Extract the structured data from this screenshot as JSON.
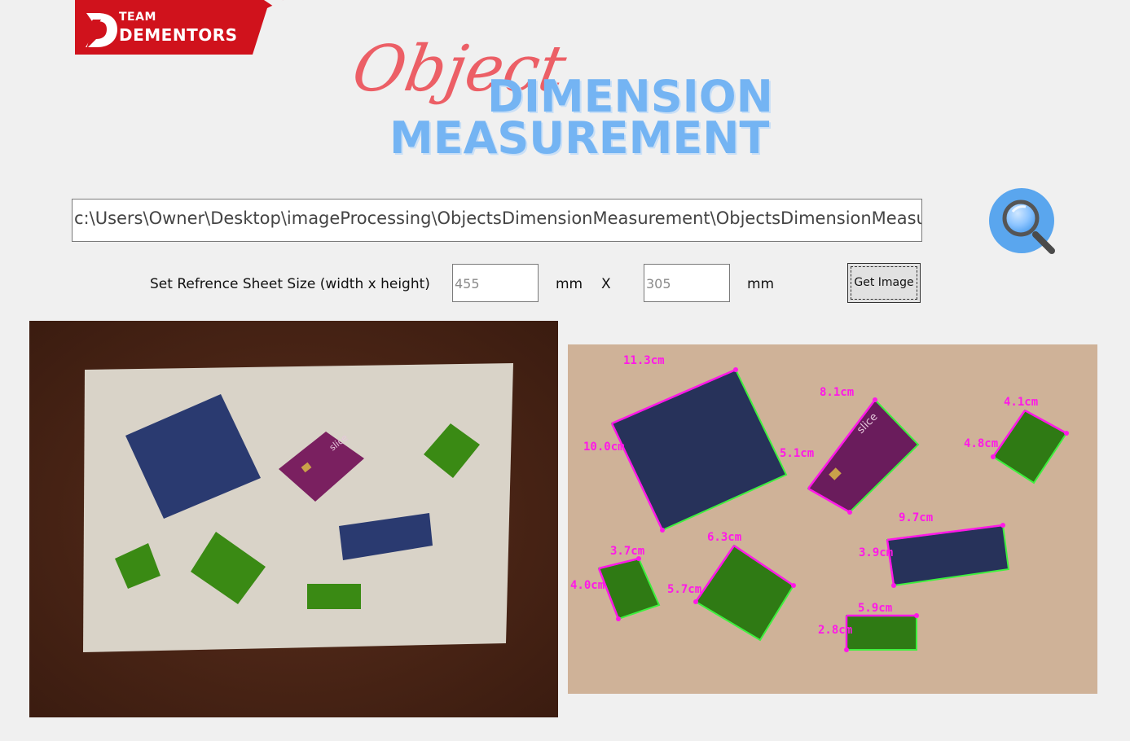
{
  "logo": {
    "team": "TEAM",
    "brand": "DEMENTORS",
    "mark": "D",
    "color": "#d0121c"
  },
  "title": {
    "script": "Object",
    "line1": "DIMENSION",
    "line2": "MEASUREMENT"
  },
  "path_field": {
    "value": "c:\\Users\\Owner\\Desktop\\imageProcessing\\ObjectsDimensionMeasurement\\ObjectsDimensionMeasur"
  },
  "search": {
    "icon": "search-icon"
  },
  "reference": {
    "label": "Set Refrence Sheet Size (width x height)",
    "width": "455",
    "height": "305",
    "unit_width": "mm",
    "separator": "X",
    "unit_height": "mm",
    "button": "Get Image"
  },
  "measurements": {
    "blue_square_width": "11.3cm",
    "blue_square_height": "10.0cm",
    "card_width": "8.1cm",
    "card_height": "5.1cm",
    "green_top_right_width": "4.1cm",
    "green_top_right_height": "4.8cm",
    "blue_rect_width": "9.7cm",
    "blue_rect_height": "3.9cm",
    "green_small_width": "3.7cm",
    "green_small_height": "4.0cm",
    "green_mid_width": "6.3cm",
    "green_mid_height": "5.7cm",
    "green_rect_width": "5.9cm",
    "green_rect_height": "2.8cm"
  },
  "card_text": "slice",
  "colors": {
    "accent_pink": "#ff18e8",
    "contour_green": "#33e233",
    "title_blue": "#74b4f3",
    "title_red": "#ec5f66"
  }
}
